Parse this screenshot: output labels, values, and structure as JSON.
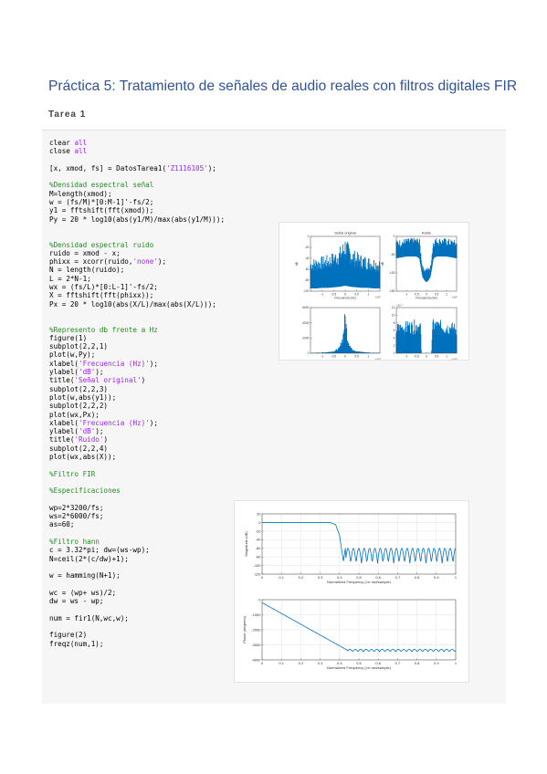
{
  "document": {
    "title": "Práctica 5: Tratamiento de señales de audio reales con filtros digitales FIR",
    "subtitle": "Tarea 1"
  },
  "code": {
    "lines": [
      [
        {
          "t": "clear ",
          "c": ""
        },
        {
          "t": "all",
          "c": "st"
        }
      ],
      [
        {
          "t": "close ",
          "c": ""
        },
        {
          "t": "all",
          "c": "st"
        }
      ],
      [],
      [
        {
          "t": "[x, xmod, fs] = DatosTarea1(",
          "c": ""
        },
        {
          "t": "'Z1116105'",
          "c": "st"
        },
        {
          "t": ");",
          "c": ""
        }
      ],
      [],
      [
        {
          "t": "%Densidad espectral señal",
          "c": "cm"
        }
      ],
      [
        {
          "t": "M=length(xmod);",
          "c": ""
        }
      ],
      [
        {
          "t": "w = (fs/M)*[0:M-1]'-fs/2;",
          "c": ""
        }
      ],
      [
        {
          "t": "y1 = fftshift(fft(xmod));",
          "c": ""
        }
      ],
      [
        {
          "t": "Py = 20 * log10(abs(y1/M)/max(abs(y1/M)));",
          "c": ""
        }
      ],
      [],
      [],
      [
        {
          "t": "%Densidad espectral ruido",
          "c": "cm"
        }
      ],
      [
        {
          "t": "ruido = xmod - x;",
          "c": ""
        }
      ],
      [
        {
          "t": "phixx = xcorr(ruido,",
          "c": ""
        },
        {
          "t": "'none'",
          "c": "st"
        },
        {
          "t": ");",
          "c": ""
        }
      ],
      [
        {
          "t": "N = length(ruido);",
          "c": ""
        }
      ],
      [
        {
          "t": "L = 2*N-1;",
          "c": ""
        }
      ],
      [
        {
          "t": "wx = (fs/L)*[0:L-1]'-fs/2;",
          "c": ""
        }
      ],
      [
        {
          "t": "X = fftshift(fft(phixx));",
          "c": ""
        }
      ],
      [
        {
          "t": "Px = 20 * log10(abs(X/L)/max(abs(X/L)));",
          "c": ""
        }
      ],
      [],
      [],
      [
        {
          "t": "%Represento db frente a Hz",
          "c": "cm"
        }
      ],
      [
        {
          "t": "figure(1)",
          "c": ""
        }
      ],
      [
        {
          "t": "subplot(2,2,1)",
          "c": ""
        }
      ],
      [
        {
          "t": "plot(w,Py);",
          "c": ""
        }
      ],
      [
        {
          "t": "xlabel(",
          "c": ""
        },
        {
          "t": "'Frecuencia (Hz)'",
          "c": "st"
        },
        {
          "t": ");",
          "c": ""
        }
      ],
      [
        {
          "t": "ylabel(",
          "c": ""
        },
        {
          "t": "'dB'",
          "c": "st"
        },
        {
          "t": ");",
          "c": ""
        }
      ],
      [
        {
          "t": "title(",
          "c": ""
        },
        {
          "t": "'Señal original'",
          "c": "st"
        },
        {
          "t": ")",
          "c": ""
        }
      ],
      [
        {
          "t": "subplot(2,2,3)",
          "c": ""
        }
      ],
      [
        {
          "t": "plot(w,abs(y1));",
          "c": ""
        }
      ],
      [
        {
          "t": "subplot(2,2,2)",
          "c": ""
        }
      ],
      [
        {
          "t": "plot(wx,Px);",
          "c": ""
        }
      ],
      [
        {
          "t": "xlabel(",
          "c": ""
        },
        {
          "t": "'Frecuencia (Hz)'",
          "c": "st"
        },
        {
          "t": ");",
          "c": ""
        }
      ],
      [
        {
          "t": "ylabel(",
          "c": ""
        },
        {
          "t": "'dB'",
          "c": "st"
        },
        {
          "t": ");",
          "c": ""
        }
      ],
      [
        {
          "t": "title(",
          "c": ""
        },
        {
          "t": "'Ruido'",
          "c": "st"
        },
        {
          "t": ")",
          "c": ""
        }
      ],
      [
        {
          "t": "subplot(2,2,4)",
          "c": ""
        }
      ],
      [
        {
          "t": "plot(wx,abs(X));",
          "c": ""
        }
      ],
      [],
      [
        {
          "t": "%Filtro FIR",
          "c": "cm"
        }
      ],
      [],
      [
        {
          "t": "%Especificaciones",
          "c": "cm"
        }
      ],
      [],
      [
        {
          "t": "wp=2*3200/fs;",
          "c": ""
        }
      ],
      [
        {
          "t": "ws=2*6000/fs;",
          "c": ""
        }
      ],
      [
        {
          "t": "as=60;",
          "c": ""
        }
      ],
      [],
      [
        {
          "t": "%Filtro hann",
          "c": "cm"
        }
      ],
      [
        {
          "t": "c = 3.32*pi; dw=(ws-wp);",
          "c": ""
        }
      ],
      [
        {
          "t": "N=ceil(2*(c/dw)+1);",
          "c": ""
        }
      ],
      [],
      [
        {
          "t": "w = hamming(N+1);",
          "c": ""
        }
      ],
      [],
      [
        {
          "t": "wc = (wp+ ws)/2;",
          "c": ""
        }
      ],
      [
        {
          "t": "dw = ws - wp;",
          "c": ""
        }
      ],
      [],
      [
        {
          "t": "num = fir1(N,wc,w);",
          "c": ""
        }
      ],
      [],
      [
        {
          "t": "figure(2)",
          "c": ""
        }
      ],
      [
        {
          "t": "freqz(num,1);",
          "c": ""
        }
      ]
    ]
  },
  "chart_data": [
    {
      "type": "line",
      "title": "Señal original",
      "xlabel": "Frecuencia (Hz)",
      "ylabel": "dB",
      "x_exponent": "×10⁴",
      "xlim": [
        -1.5,
        1.5
      ],
      "ylim": [
        -100,
        0
      ],
      "xticks": [
        "-1",
        "-0.5",
        "0",
        "0.5",
        "1"
      ],
      "yticks": [
        "0",
        "-20",
        "-40",
        "-60",
        "-80",
        "-100"
      ],
      "color": "#0072bd",
      "series": [
        {
          "x": [
            -1.5,
            -1.25,
            -1.0,
            -0.75,
            -0.5,
            -0.25,
            0,
            0.25,
            0.5,
            0.75,
            1.0,
            1.25,
            1.5
          ],
          "upper": [
            -40,
            -38,
            -36,
            -33,
            -28,
            -20,
            0,
            -20,
            -28,
            -33,
            -36,
            -38,
            -40
          ],
          "lower": [
            -95,
            -95,
            -94,
            -94,
            -93,
            -92,
            -90,
            -92,
            -93,
            -94,
            -94,
            -95,
            -95
          ]
        }
      ]
    },
    {
      "type": "line",
      "title": "Ruido",
      "xlabel": "Frecuencia (Hz)",
      "ylabel": "dB",
      "x_exponent": "×10⁴",
      "xlim": [
        -1.5,
        1.5
      ],
      "ylim": [
        -150,
        0
      ],
      "xticks": [
        "-1",
        "-0.5",
        "0",
        "0.5",
        "1"
      ],
      "yticks": [
        "0",
        "-50",
        "-100",
        "-150"
      ],
      "color": "#0072bd",
      "series": [
        {
          "x": [
            -1.5,
            -1.0,
            -0.5,
            -0.35,
            -0.2,
            -0.1,
            0,
            0.1,
            0.2,
            0.35,
            0.5,
            1.0,
            1.5
          ],
          "upper": [
            -10,
            -5,
            -3,
            -3,
            -80,
            -85,
            -85,
            -85,
            -80,
            -3,
            -3,
            -5,
            -10
          ],
          "lower": [
            -60,
            -55,
            -55,
            -60,
            -110,
            -120,
            -125,
            -120,
            -110,
            -60,
            -55,
            -55,
            -60
          ]
        }
      ]
    },
    {
      "type": "line",
      "title": "",
      "xlabel": "",
      "ylabel": "",
      "x_exponent": "×10⁴",
      "xlim": [
        -1.5,
        1.5
      ],
      "ylim": [
        0,
        6000
      ],
      "xticks": [
        "-1",
        "-0.5",
        "0",
        "0.5",
        "1"
      ],
      "yticks": [
        "6000",
        "4000",
        "2000",
        "0"
      ],
      "color": "#0072bd",
      "series": [
        {
          "x": [
            -1.5,
            -1.0,
            -0.5,
            -0.25,
            -0.1,
            0,
            0.1,
            0.25,
            0.5,
            1.0,
            1.5
          ],
          "upper": [
            50,
            100,
            300,
            800,
            2500,
            6000,
            2500,
            800,
            300,
            100,
            50
          ],
          "lower": [
            0,
            0,
            0,
            0,
            0,
            0,
            0,
            0,
            0,
            0,
            0
          ]
        }
      ]
    },
    {
      "type": "line",
      "title": "",
      "xlabel": "",
      "ylabel": "",
      "x_exponent": "×10⁴",
      "y_exponent": "×10⁻⁴",
      "xlim": [
        -1.5,
        1.5
      ],
      "ylim": [
        0,
        12
      ],
      "xticks": [
        "-1",
        "-0.5",
        "0",
        "0.5",
        "1"
      ],
      "yticks": [
        "12",
        "10",
        "8",
        "6",
        "4",
        "2",
        "0"
      ],
      "color": "#0072bd",
      "series": [
        {
          "x": [
            -1.5,
            -1.0,
            -0.5,
            -0.35,
            -0.3,
            -0.25,
            0.25,
            0.3,
            0.35,
            0.5,
            1.0,
            1.5
          ],
          "upper": [
            8,
            8.5,
            9,
            9,
            9,
            0,
            0,
            9,
            9,
            9,
            8.5,
            8
          ],
          "lower": [
            0,
            0,
            0,
            0,
            0,
            0,
            0,
            0,
            0,
            0,
            0,
            0
          ]
        }
      ]
    },
    {
      "type": "line",
      "title": "",
      "xlabel": "Normalized Frequency (×π rad/sample)",
      "ylabel": "Magnitude (dB)",
      "xlim": [
        0,
        1
      ],
      "ylim": [
        -120,
        20
      ],
      "xticks": [
        "0",
        "0.1",
        "0.2",
        "0.3",
        "0.4",
        "0.5",
        "0.6",
        "0.7",
        "0.8",
        "0.9",
        "1"
      ],
      "yticks": [
        "20",
        "0",
        "-20",
        "-40",
        "-60",
        "-80",
        "-100",
        "-120"
      ],
      "grid": true,
      "color": "#0072bd",
      "series": [
        {
          "x": [
            0,
            0.05,
            0.1,
            0.15,
            0.2,
            0.25,
            0.3,
            0.35,
            0.38,
            0.4,
            0.42,
            0.43,
            0.44,
            1
          ],
          "y": [
            0,
            0,
            0,
            0,
            0,
            0,
            0,
            0,
            -5,
            -30,
            -90,
            -60,
            -65,
            -75
          ],
          "ripple_start": 0.43,
          "ripple_top": -60,
          "ripple_bottom": -95
        }
      ]
    },
    {
      "type": "line",
      "title": "",
      "xlabel": "Normalized Frequency (×π rad/sample)",
      "ylabel": "Phase (degrees)",
      "xlim": [
        0,
        1
      ],
      "ylim": [
        -4000,
        0
      ],
      "xticks": [
        "0",
        "0.1",
        "0.2",
        "0.3",
        "0.4",
        "0.5",
        "0.6",
        "0.7",
        "0.8",
        "0.9",
        "1"
      ],
      "yticks": [
        "0",
        "-1000",
        "-2000",
        "-3000",
        "-4000"
      ],
      "grid": true,
      "color": "#0072bd",
      "series": [
        {
          "x": [
            0,
            0.44,
            1
          ],
          "y": [
            -200,
            -3350,
            -3350
          ],
          "ripple_start": 0.44,
          "ripple_top": -3300,
          "ripple_bottom": -3450
        }
      ]
    }
  ]
}
